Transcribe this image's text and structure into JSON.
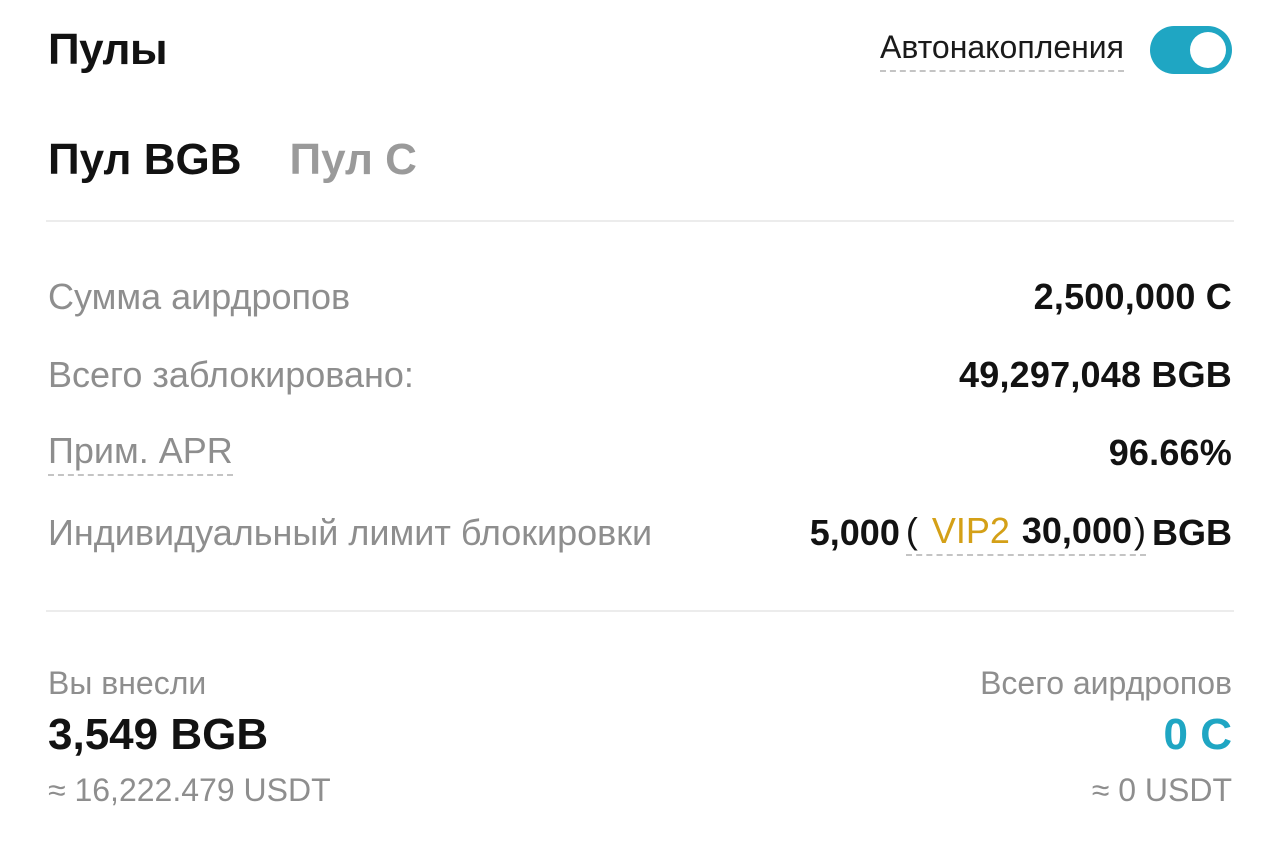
{
  "header": {
    "title": "Пулы",
    "auto_label": "Автонакопления",
    "auto_enabled": true
  },
  "tabs": [
    {
      "label": "Пул BGB",
      "active": true
    },
    {
      "label": "Пул C",
      "active": false
    }
  ],
  "info": {
    "airdrop_sum_label": "Сумма аирдропов",
    "airdrop_sum_value": "2,500,000 C",
    "total_locked_label": "Всего заблокировано:",
    "total_locked_value": "49,297,048 BGB",
    "apr_label": "Прим. APR",
    "apr_value": "96.66%",
    "limit_label": "Индивидуальный лимит блокировки",
    "limit_value": "5,000",
    "limit_paren_open": "(",
    "limit_vip": "VIP2",
    "limit_vip_value": "30,000",
    "limit_paren_close": ")",
    "limit_unit": "BGB"
  },
  "summary": {
    "deposited_label": "Вы внесли",
    "deposited_value": "3,549 BGB",
    "deposited_usdt": "≈ 16,222.479 USDT",
    "airdrops_label": "Всего аирдропов",
    "airdrops_value": "0 C",
    "airdrops_usdt": "≈ 0 USDT"
  },
  "colors": {
    "accent": "#1fa6c3",
    "vip": "#d4a017",
    "muted": "#8e8e8e"
  }
}
